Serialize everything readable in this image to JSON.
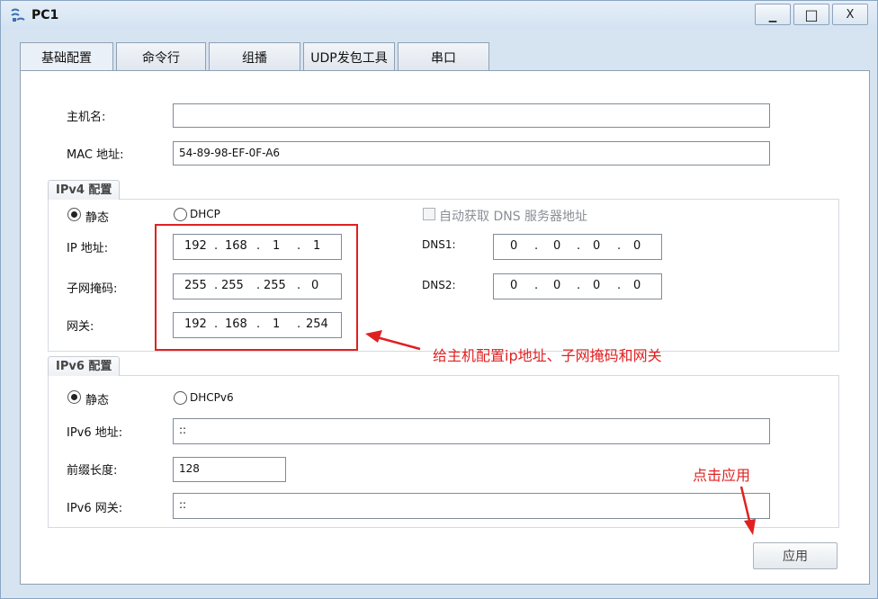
{
  "window": {
    "title": "PC1",
    "controls": {
      "minimize": "▁",
      "maximize": "□",
      "close": "X"
    }
  },
  "tabs": [
    {
      "label": "基础配置",
      "active": true
    },
    {
      "label": "命令行"
    },
    {
      "label": "组播"
    },
    {
      "label": "UDP发包工具"
    },
    {
      "label": "串口"
    }
  ],
  "basic": {
    "hostname_label": "主机名:",
    "hostname_value": "",
    "mac_label": "MAC 地址:",
    "mac_value": "54-89-98-EF-0F-A6"
  },
  "ipv4": {
    "group_title": "IPv4 配置",
    "static_label": "静态",
    "dhcp_label": "DHCP",
    "auto_dns_label": "自动获取 DNS 服务器地址",
    "ip_label": "IP 地址:",
    "ip": [
      "192",
      "168",
      "1",
      "1"
    ],
    "mask_label": "子网掩码:",
    "mask": [
      "255",
      "255",
      "255",
      "0"
    ],
    "gateway_label": "网关:",
    "gateway": [
      "192",
      "168",
      "1",
      "254"
    ],
    "dns1_label": "DNS1:",
    "dns1": [
      "0",
      "0",
      "0",
      "0"
    ],
    "dns2_label": "DNS2:",
    "dns2": [
      "0",
      "0",
      "0",
      "0"
    ]
  },
  "ipv6": {
    "group_title": "IPv6 配置",
    "static_label": "静态",
    "dhcp_label": "DHCPv6",
    "addr_label": "IPv6 地址:",
    "addr_value": "::",
    "prefix_label": "前缀长度:",
    "prefix_value": "128",
    "gateway_label": "IPv6 网关:",
    "gateway_value": "::"
  },
  "annotations": {
    "config_note": "给主机配置ip地址、子网掩码和网关",
    "apply_note": "点击应用",
    "color": "#e02020"
  },
  "apply_button": "应用",
  "icons": {
    "app": "network-pc-icon",
    "radio_checked": "radio-checked-icon",
    "radio_unchecked": "radio-unchecked-icon",
    "checkbox": "checkbox-icon"
  }
}
